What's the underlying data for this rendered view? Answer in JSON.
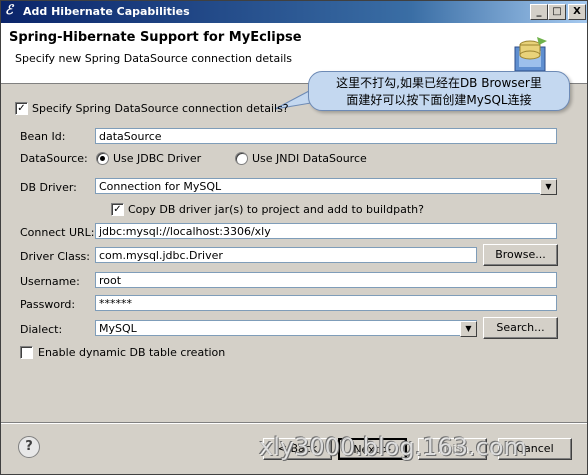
{
  "window": {
    "title": "Add Hibernate Capabilities",
    "min_label": "_",
    "max_label": "□",
    "close_label": "X"
  },
  "header": {
    "title": "Spring-Hibernate Support for MyEclipse",
    "subtitle": "Specify new Spring DataSource connection details"
  },
  "callout": {
    "line1": "这里不打勾,如果已经在DB Browser里",
    "line2": "面建好可以按下面创建MySQL连接"
  },
  "specify": {
    "label": "Specify Spring DataSource connection details?",
    "checked": true,
    "mark": "✓"
  },
  "bean_id": {
    "label": "Bean Id:",
    "value": "dataSource"
  },
  "datasource": {
    "label": "DataSource:",
    "option1": "Use JDBC Driver",
    "option2": "Use JNDI DataSource",
    "selected": "Use JDBC Driver"
  },
  "db_driver": {
    "label": "DB Driver:",
    "value": "Connection for MySQL",
    "arrow": "▼"
  },
  "copy_jar": {
    "label": "Copy DB driver jar(s) to project and add to buildpath?",
    "checked": true,
    "mark": "✓"
  },
  "connect_url": {
    "label": "Connect URL:",
    "value": "jdbc:mysql://localhost:3306/xly"
  },
  "driver_class": {
    "label": "Driver Class:",
    "value": "com.mysql.jdbc.Driver",
    "browse": "Browse..."
  },
  "username": {
    "label": "Username:",
    "value": "root"
  },
  "password": {
    "label": "Password:",
    "value": "******"
  },
  "dialect": {
    "label": "Dialect:",
    "value": "MySQL",
    "arrow": "▼",
    "search": "Search..."
  },
  "dynamic": {
    "label": "Enable dynamic DB table creation",
    "checked": false
  },
  "footer": {
    "help": "?",
    "back": "< Back",
    "next": "Next >",
    "finish": "Finish",
    "cancel": "Cancel",
    "watermark": "xly3000.blog.163.com"
  }
}
